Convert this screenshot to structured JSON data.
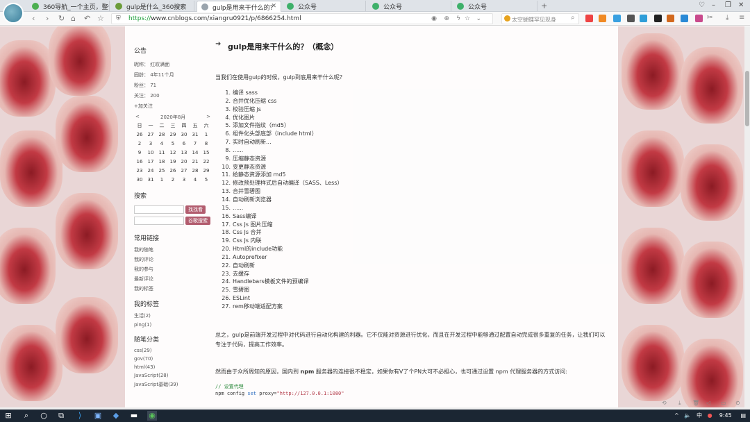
{
  "tabs": [
    {
      "label": "360导航_一个主页，整个",
      "color": "#4caf50"
    },
    {
      "label": "gulp是什么_360搜索",
      "color": "#6b9c3a"
    },
    {
      "label": "gulp是用来干什么的?",
      "color": "#9aa4ad",
      "active": true
    },
    {
      "label": "公众号",
      "color": "#3eb06a"
    },
    {
      "label": "公众号",
      "color": "#3eb06a"
    },
    {
      "label": "公众号",
      "color": "#3eb06a"
    }
  ],
  "address": {
    "scheme": "https://",
    "host": "www.cnblogs.com",
    "path": "/xiangru0921/p/6866254.html"
  },
  "search": {
    "placeholder": "太空蝴蝶罕见现身"
  },
  "sidebar": {
    "notice_title": "公告",
    "nickname": "昵称：  红叹满面",
    "age": "园龄：  4年11个月",
    "fans": "粉丝：  71",
    "follow": "关注：  200",
    "add_follow": "+加关注",
    "calendar": {
      "prev": "<",
      "next": ">",
      "month": "2020年8月",
      "weekdays": [
        "日",
        "一",
        "二",
        "三",
        "四",
        "五",
        "六"
      ],
      "weeks": [
        [
          "26",
          "27",
          "28",
          "29",
          "30",
          "31",
          "1"
        ],
        [
          "2",
          "3",
          "4",
          "5",
          "6",
          "7",
          "8"
        ],
        [
          "9",
          "10",
          "11",
          "12",
          "13",
          "14",
          "15"
        ],
        [
          "16",
          "17",
          "18",
          "19",
          "20",
          "21",
          "22"
        ],
        [
          "23",
          "24",
          "25",
          "26",
          "27",
          "28",
          "29"
        ],
        [
          "30",
          "31",
          "1",
          "2",
          "3",
          "4",
          "5"
        ]
      ]
    },
    "search_title": "搜索",
    "find_btn": "找找看",
    "google_btn": "谷歌搜索",
    "links_title": "常用链接",
    "links": [
      "我的随笔",
      "我的评论",
      "我的参与",
      "最新评论",
      "我的标签"
    ],
    "tags_title": "我的标签",
    "tags": [
      "生活(2)",
      "ping(1)"
    ],
    "cats_title": "随笔分类",
    "cats": [
      "css(29)",
      "gov(70)",
      "html(43)",
      "JavaScript(28)",
      "JavaScript基础(39)"
    ]
  },
  "article": {
    "title": "gulp是用来干什么的？（概念）",
    "intro": "当我们在使用gulp的时候，gulp到底用来干什么呢？",
    "steps": [
      "编译 sass",
      "合并优化压缩 css",
      "校验压缩 js",
      "优化图片",
      "添加文件指纹（md5）",
      "组件化头部底部（include html）",
      "实时自动刷新...",
      "......",
      "压缩静态资源",
      "变更静态资源",
      "给静态资源添加 md5",
      "修改预处理样式后自动编译（SASS、Less）",
      "合并雪碧图",
      "自动刷新浏览器",
      "......",
      "Sass编译",
      "Css Js 图片压缩",
      "Css Js 合并",
      "Css Js 内联",
      "Html的include功能",
      "Autoprefixer",
      "自动刷新",
      "去缓存",
      "Handlebars模板文件的预编译",
      "雪碧图",
      "ESLint",
      "rem移动端适配方案"
    ],
    "summary": "总之，gulp是前端开发过程中对代码进行自动化构建的利器。它不仅能对资源进行优化，而且在开发过程中能够通过配置自动完成很多重复的任务，让我们可以专注于代码，提高工作效率。",
    "net_pre": "然而由于众所周知的原因，国内到 ",
    "net_bold": "npm",
    "net_post": " 服务器的连接很不稳定，如果你有V了个PN大可不必担心，也可通过设置 npm 代理服务器的方式访问:",
    "code_comment": "// 设置代理",
    "code_cmd": "npm config ",
    "code_kw": "set",
    "code_arg": " proxy=",
    "code_str": "\"http://127.0.0.1:1080\""
  },
  "taskbar": {
    "time": "9:45",
    "ime": "中"
  }
}
